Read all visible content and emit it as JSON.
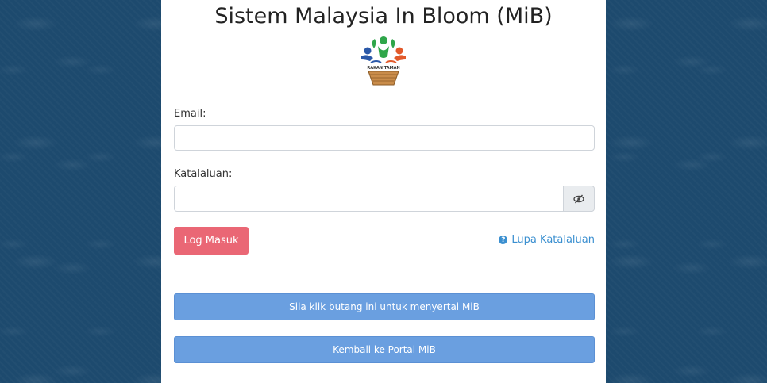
{
  "header": {
    "title": "Sistem Malaysia In Bloom (MiB)"
  },
  "logo": {
    "caption": "RAKAN TAMAN"
  },
  "form": {
    "email_label": "Email:",
    "email_value": "",
    "password_label": "Katalaluan:",
    "password_value": "",
    "toggle_icon": "eye-slash-icon",
    "login_label": "Log Masuk",
    "forgot_icon": "question-circle-icon",
    "forgot_label": "Lupa Katalaluan"
  },
  "actions": {
    "join_label": "Sila klik butang ini untuk menyertai MiB",
    "portal_label": "Kembali ke Portal MiB"
  },
  "colors": {
    "background": "#1d4a6e",
    "login_button": "#ea6775",
    "link": "#3a8fd0",
    "wide_button": "#6a9fe0"
  }
}
